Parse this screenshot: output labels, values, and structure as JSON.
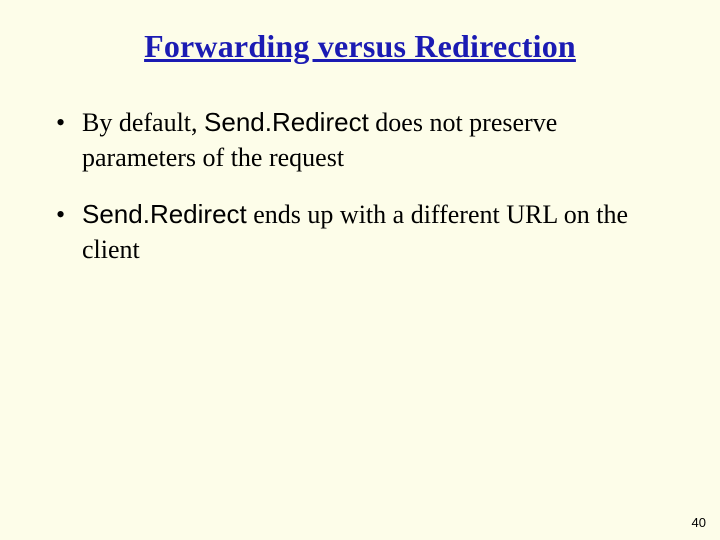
{
  "slide": {
    "title": "Forwarding versus Redirection",
    "bullets": [
      {
        "prefix": "By default, ",
        "code": "Send.Redirect",
        "suffix": " does not preserve parameters of the request"
      },
      {
        "prefix": "",
        "code": "Send.Redirect",
        "suffix": " ends up with a different URL on the client"
      }
    ],
    "page_number": "40"
  }
}
